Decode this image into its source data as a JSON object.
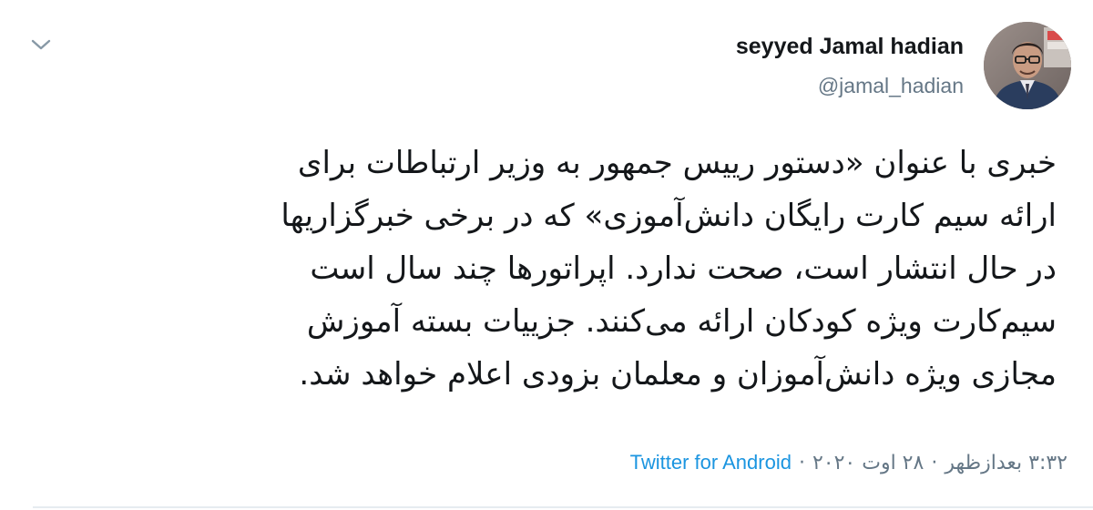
{
  "tweet": {
    "display_name": "seyyed Jamal hadian",
    "handle": "@jamal_hadian",
    "text_lines": [
      "خبری با عنوان «دستور رییس جمهور به وزیر ارتباطات برای",
      "ارائه سیم کارت رایگان دانش‌آموزی» که در برخی خبرگزاریها",
      "در حال انتشار است، صحت ندارد. اپراتورها چند سال است",
      "سیم‌کارت ویژه کودکان ارائه می‌کنند. جزییات بسته آموزش",
      "مجازی ویژه دانش‌آموزان و معلمان بزودی اعلام خواهد شد."
    ],
    "time": "۳:۳۲ بعدازظهر",
    "date": "۲۸ اوت ۲۰۲۰",
    "separator": "·",
    "source": "Twitter for Android"
  },
  "colors": {
    "text": "#14171a",
    "muted": "#657786",
    "link": "#1b95e0",
    "divider": "#e6ecf0"
  },
  "icons": {
    "menu": "chevron-down-icon",
    "avatar": "profile-photo"
  }
}
